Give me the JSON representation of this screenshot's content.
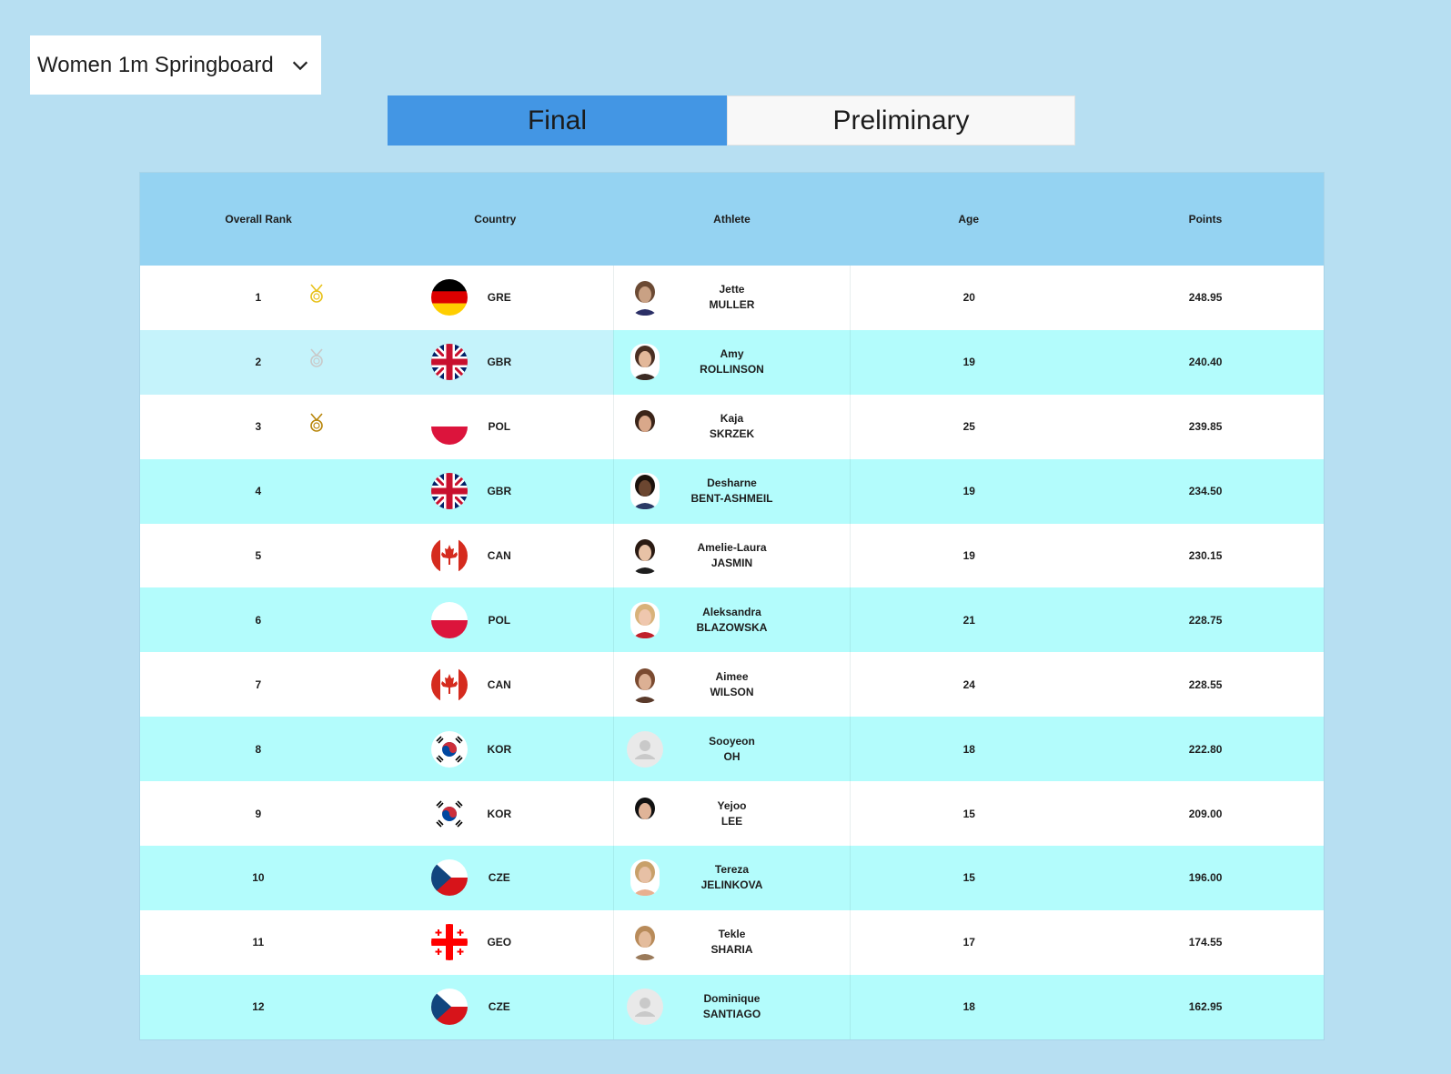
{
  "event_select": {
    "value": "Women 1m Springboard"
  },
  "tabs": [
    {
      "label": "Final",
      "active": true
    },
    {
      "label": "Preliminary",
      "active": false
    }
  ],
  "columns": {
    "rank": "Overall Rank",
    "country": "Country",
    "athlete": "Athlete",
    "age": "Age",
    "points": "Points"
  },
  "colors": {
    "gold": "#e8c21c",
    "silver": "#c9c9c9",
    "bronze": "#b8860b",
    "row_alt": "#b3fcfc",
    "header": "#95d3f2",
    "tab_active": "#4396e4"
  },
  "rows": [
    {
      "rank": "1",
      "medal": "gold",
      "flag": "GER",
      "code": "GRE",
      "first": "Jette",
      "last": "MULLER",
      "age": "20",
      "points": "248.95",
      "photo": "photo"
    },
    {
      "rank": "2",
      "medal": "silver",
      "flag": "GBR",
      "code": "GBR",
      "first": "Amy",
      "last": "ROLLINSON",
      "age": "19",
      "points": "240.40",
      "photo": "photo"
    },
    {
      "rank": "3",
      "medal": "bronze",
      "flag": "POL",
      "code": "POL",
      "first": "Kaja",
      "last": "SKRZEK",
      "age": "25",
      "points": "239.85",
      "photo": "photo"
    },
    {
      "rank": "4",
      "medal": "",
      "flag": "GBR",
      "code": "GBR",
      "first": "Desharne",
      "last": "BENT-ASHMEIL",
      "age": "19",
      "points": "234.50",
      "photo": "photo"
    },
    {
      "rank": "5",
      "medal": "",
      "flag": "CAN",
      "code": "CAN",
      "first": "Amelie-Laura",
      "last": "JASMIN",
      "age": "19",
      "points": "230.15",
      "photo": "photo"
    },
    {
      "rank": "6",
      "medal": "",
      "flag": "POL",
      "code": "POL",
      "first": "Aleksandra",
      "last": "BLAZOWSKA",
      "age": "21",
      "points": "228.75",
      "photo": "photo"
    },
    {
      "rank": "7",
      "medal": "",
      "flag": "CAN",
      "code": "CAN",
      "first": "Aimee",
      "last": "WILSON",
      "age": "24",
      "points": "228.55",
      "photo": "photo"
    },
    {
      "rank": "8",
      "medal": "",
      "flag": "KOR",
      "code": "KOR",
      "first": "Sooyeon",
      "last": "OH",
      "age": "18",
      "points": "222.80",
      "photo": "placeholder"
    },
    {
      "rank": "9",
      "medal": "",
      "flag": "KOR",
      "code": "KOR",
      "first": "Yejoo",
      "last": "LEE",
      "age": "15",
      "points": "209.00",
      "photo": "photo"
    },
    {
      "rank": "10",
      "medal": "",
      "flag": "CZE",
      "code": "CZE",
      "first": "Tereza",
      "last": "JELINKOVA",
      "age": "15",
      "points": "196.00",
      "photo": "photo"
    },
    {
      "rank": "11",
      "medal": "",
      "flag": "GEO",
      "code": "GEO",
      "first": "Tekle",
      "last": "SHARIA",
      "age": "17",
      "points": "174.55",
      "photo": "photo"
    },
    {
      "rank": "12",
      "medal": "",
      "flag": "CZE",
      "code": "CZE",
      "first": "Dominique",
      "last": "SANTIAGO",
      "age": "18",
      "points": "162.95",
      "photo": "placeholder"
    }
  ]
}
